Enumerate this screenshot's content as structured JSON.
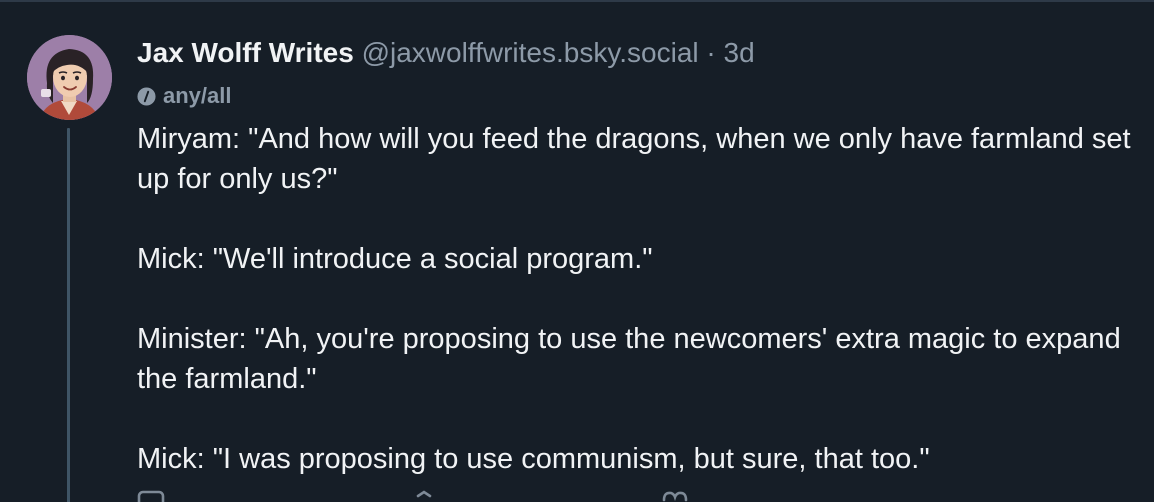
{
  "post": {
    "author": {
      "display_name": "Jax Wolff Writes",
      "handle": "@jaxwolffwrites.bsky.social",
      "separator": "·",
      "time_ago": "3d"
    },
    "label": {
      "icon": "info-icon",
      "text": "any/all"
    },
    "paragraphs": [
      "Miryam: \"And how will you feed the dragons, when we only have farmland set up for only us?\"",
      "Mick: \"We'll introduce a social program.\"",
      "Minister: \"Ah, you're proposing to use the newcomers' extra magic to expand the farmland.\"",
      "Mick: \"I was proposing to use communism, but sure, that too.\""
    ],
    "actions": [
      {
        "name": "reply",
        "icon": "reply-icon"
      },
      {
        "name": "repost",
        "icon": "repost-icon"
      },
      {
        "name": "like",
        "icon": "heart-icon"
      }
    ]
  },
  "colors": {
    "background": "#161e27",
    "text_primary": "#f1f3f5",
    "text_secondary": "#8d9aa8",
    "thread_line": "#3f5566"
  }
}
